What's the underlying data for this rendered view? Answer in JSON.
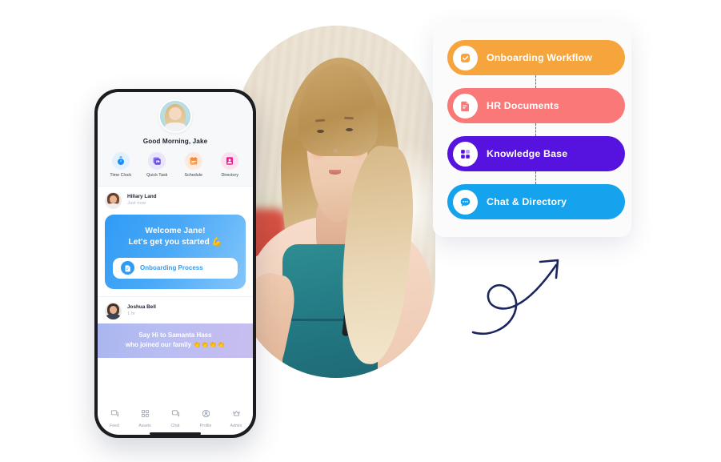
{
  "phone": {
    "header": {
      "avatar_icon": "user-avatar-photo",
      "greeting": "Good Morning, Jake"
    },
    "quick_actions": [
      {
        "label": "Time Clock",
        "icon": "stopwatch-icon",
        "color": "#1b8ef5",
        "bg": "#e3f0fd"
      },
      {
        "label": "Quick Task",
        "icon": "task-card-icon",
        "color": "#6b4ce0",
        "bg": "#e9e6fb"
      },
      {
        "label": "Schedule",
        "icon": "calendar-icon",
        "color": "#f79a4f",
        "bg": "#fdeadd"
      },
      {
        "label": "Directory",
        "icon": "contact-card-icon",
        "color": "#e8218f",
        "bg": "#fce0ef"
      }
    ],
    "posts": [
      {
        "author": "Hillary Land",
        "time": "Just now",
        "avatar_icon": "hillary-avatar",
        "card": {
          "title_line1": "Welcome Jane!",
          "title_line2": "Let's get you started 💪",
          "button_label": "Onboarding Process",
          "button_icon": "document-icon"
        }
      },
      {
        "author": "Joshua Bell",
        "time": "1 hr",
        "avatar_icon": "joshua-avatar",
        "promo": {
          "line1": "Say Hi to Samanta Hass",
          "line2": "who joined our family 👏👏👏👏"
        }
      }
    ],
    "tabbar": [
      {
        "label": "Feed",
        "icon": "feed-icon"
      },
      {
        "label": "Assets",
        "icon": "grid-assets-icon"
      },
      {
        "label": "Chat",
        "icon": "chat-icon"
      },
      {
        "label": "Profile",
        "icon": "profile-icon"
      },
      {
        "label": "Admin",
        "icon": "crown-admin-icon"
      }
    ]
  },
  "feature_panel": {
    "items": [
      {
        "label": "Onboarding Workflow",
        "icon": "check-square-icon",
        "color": "#f6a43c",
        "icon_color": "#f6a43c"
      },
      {
        "label": "HR Documents",
        "icon": "document-lines-icon",
        "color": "#fb7878",
        "icon_color": "#fb7878"
      },
      {
        "label": "Knowledge Base",
        "icon": "grid-four-icon",
        "color": "#5613e0",
        "icon_color": "#5613e0"
      },
      {
        "label": "Chat & Directory",
        "icon": "chat-dots-icon",
        "color": "#15a3ee",
        "icon_color": "#15a3ee"
      }
    ]
  },
  "decor": {
    "arrow_icon": "curved-arrow-icon",
    "arrow_color": "#1b2560",
    "hero_photo_icon": "employee-photo"
  }
}
